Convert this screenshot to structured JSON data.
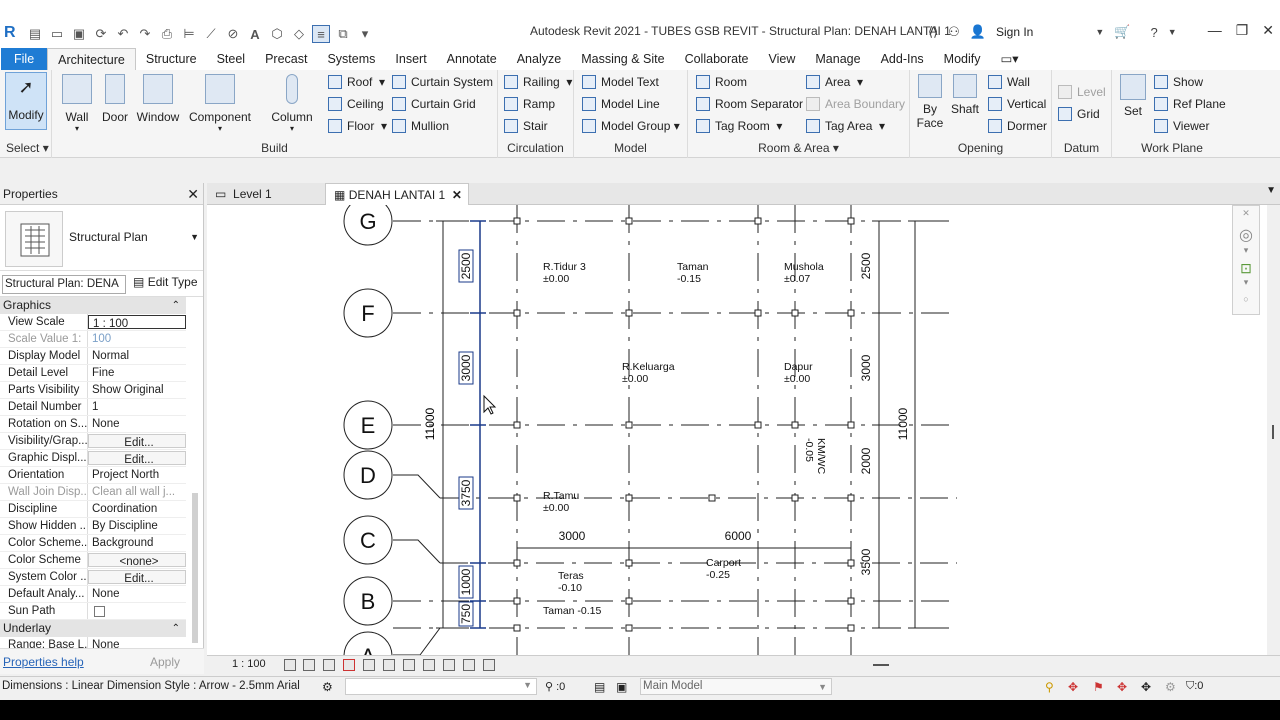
{
  "titlebar": {
    "title": "Autodesk Revit 2021 - TUBES GSB REVIT - Structural Plan: DENAH LANTAI 1",
    "sign_in": "Sign In"
  },
  "tabs": [
    "File",
    "Architecture",
    "Structure",
    "Steel",
    "Precast",
    "Systems",
    "Insert",
    "Annotate",
    "Analyze",
    "Massing & Site",
    "Collaborate",
    "View",
    "Manage",
    "Add-Ins",
    "Modify"
  ],
  "ribbon": {
    "select": {
      "modify": "Modify",
      "label": "Select"
    },
    "build": {
      "wall": "Wall",
      "door": "Door",
      "window": "Window",
      "component": "Component",
      "column": "Column",
      "roof": "Roof",
      "ceiling": "Ceiling",
      "floor": "Floor",
      "curtain_system": "Curtain System",
      "curtain_grid": "Curtain Grid",
      "mullion": "Mullion",
      "label": "Build"
    },
    "circulation": {
      "railing": "Railing",
      "ramp": "Ramp",
      "stair": "Stair",
      "label": "Circulation"
    },
    "model": {
      "model_text": "Model Text",
      "model_line": "Model Line",
      "model_group": "Model Group",
      "label": "Model"
    },
    "room_area": {
      "room": "Room",
      "room_separator": "Room Separator",
      "tag_room": "Tag Room",
      "area": "Area",
      "area_boundary": "Area Boundary",
      "tag_area": "Tag Area",
      "label": "Room & Area"
    },
    "opening": {
      "by_face_1": "By",
      "by_face_2": "Face",
      "shaft": "Shaft",
      "wall": "Wall",
      "vertical": "Vertical",
      "dormer": "Dormer",
      "label": "Opening"
    },
    "datum": {
      "level": "Level",
      "grid": "Grid",
      "label": "Datum"
    },
    "work_plane": {
      "set": "Set",
      "show": "Show",
      "ref_plane": "Ref Plane",
      "viewer": "Viewer",
      "label": "Work Plane"
    }
  },
  "properties": {
    "title": "Properties",
    "type_name": "Structural Plan",
    "instance": "Structural Plan: DENA",
    "edit_type": "Edit Type",
    "group_graphics": "Graphics",
    "rows": [
      {
        "name": "View Scale",
        "value": "1 : 100"
      },
      {
        "name": "Scale Value    1:",
        "value": "100"
      },
      {
        "name": "Display Model",
        "value": "Normal"
      },
      {
        "name": "Detail Level",
        "value": "Fine"
      },
      {
        "name": "Parts Visibility",
        "value": "Show Original"
      },
      {
        "name": "Detail Number",
        "value": "1"
      },
      {
        "name": "Rotation on S...",
        "value": "None"
      },
      {
        "name": "Visibility/Grap...",
        "value": "Edit..."
      },
      {
        "name": "Graphic Displ...",
        "value": "Edit..."
      },
      {
        "name": "Orientation",
        "value": "Project North"
      },
      {
        "name": "Wall Join Disp...",
        "value": "Clean all wall j..."
      },
      {
        "name": "Discipline",
        "value": "Coordination"
      },
      {
        "name": "Show Hidden ...",
        "value": "By Discipline"
      },
      {
        "name": "Color Scheme...",
        "value": "Background"
      },
      {
        "name": "Color Scheme",
        "value": "<none>"
      },
      {
        "name": "System Color ...",
        "value": "Edit..."
      },
      {
        "name": "Default Analy...",
        "value": "None"
      },
      {
        "name": "Sun Path",
        "value": ""
      }
    ],
    "group_underlay": "Underlay",
    "underlay_row": {
      "name": "Range: Base L...",
      "value": "None"
    },
    "help": "Properties help",
    "apply": "Apply"
  },
  "view_tabs": [
    {
      "label": "Level 1"
    },
    {
      "label": "DENAH LANTAI 1"
    }
  ],
  "drawing": {
    "grids": [
      "G",
      "F",
      "E",
      "D",
      "C",
      "B",
      "A"
    ],
    "left_dims": [
      "2500",
      "3000",
      "3750",
      "1000",
      "750"
    ],
    "overall_left": "11000",
    "overall_right": "11000",
    "right_dims": [
      "2500",
      "3000",
      "2000",
      "3500"
    ],
    "horizontal_dims": [
      "3000",
      "6000"
    ],
    "rooms": [
      {
        "name": "R.Tidur 3",
        "level": "±0.00"
      },
      {
        "name": "Taman",
        "level": "-0.15"
      },
      {
        "name": "Mushola",
        "level": "±0.07"
      },
      {
        "name": "R.Keluarga",
        "level": "±0.00"
      },
      {
        "name": "Dapur",
        "level": "±0.00"
      },
      {
        "name": "KM/WC",
        "level": "-0.05"
      },
      {
        "name": "R.Tamu",
        "level": "±0.00"
      },
      {
        "name": "Teras",
        "level": "-0.10"
      },
      {
        "name": "Carport",
        "level": "-0.25"
      },
      {
        "name": "Taman -0.15",
        "level": ""
      }
    ]
  },
  "view_control": {
    "scale": "1 : 100"
  },
  "status": {
    "text": "Dimensions : Linear Dimension Style : Arrow - 2.5mm Arial",
    "selection": ":0",
    "model": "Main Model",
    "filter": ":0"
  },
  "colors": {
    "file_tab": "#1f7cd4",
    "selected_dim": "#1a3a8a"
  }
}
